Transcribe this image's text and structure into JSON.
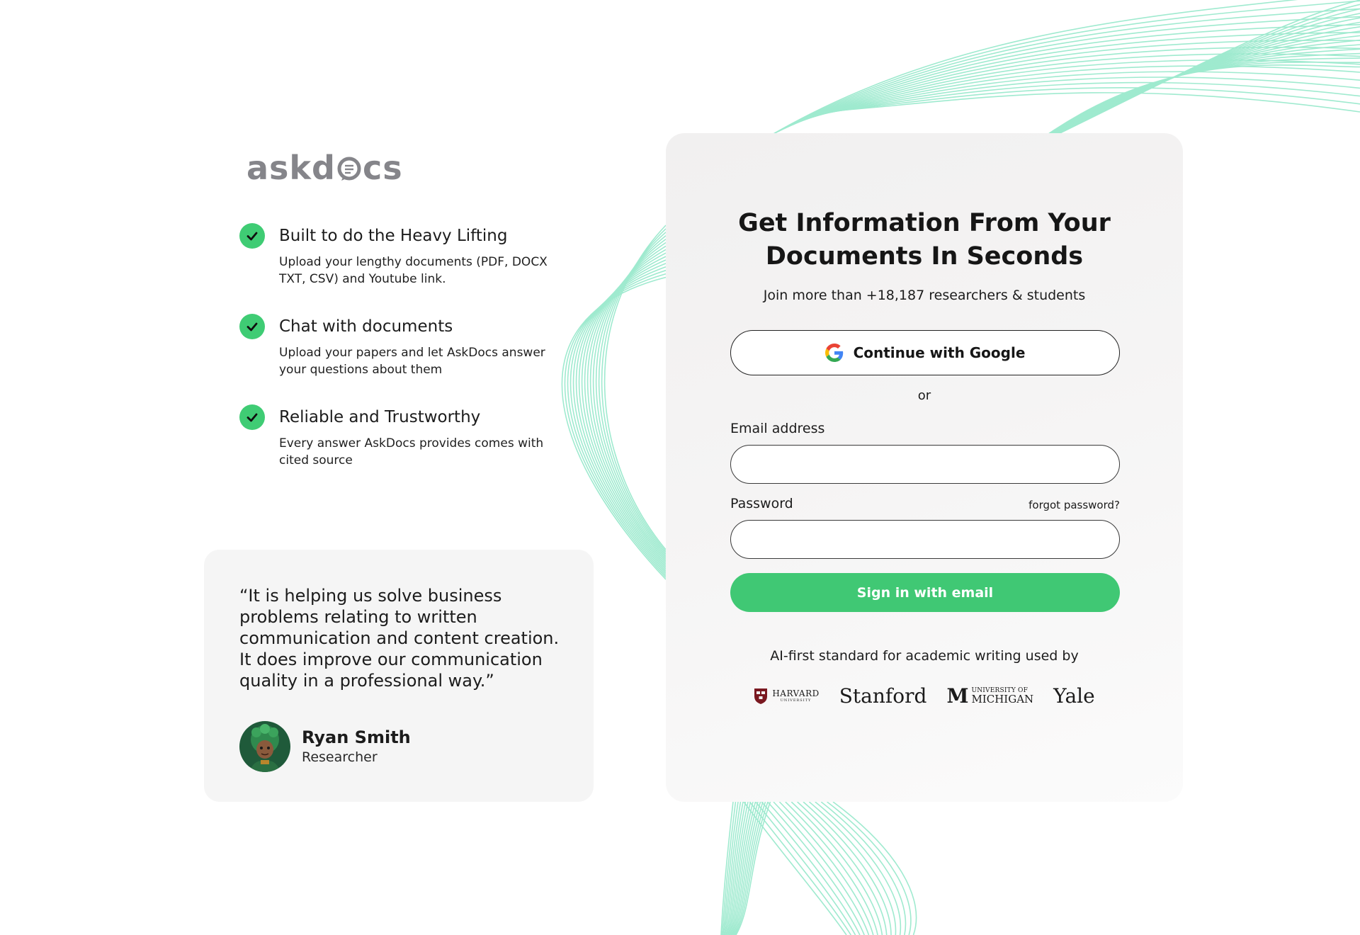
{
  "brand": {
    "logo_prefix": "askd",
    "logo_suffix": "cs",
    "accent_color": "#3fcc74",
    "wave_color": "#7fe3bf"
  },
  "features": [
    {
      "title": "Built to do the Heavy Lifting",
      "description": "Upload your lengthy documents (PDF, DOCX TXT, CSV) and Youtube link."
    },
    {
      "title": "Chat with documents",
      "description": "Upload your papers and let AskDocs answer your questions about them"
    },
    {
      "title": "Reliable and Trustworthy",
      "description": "Every answer AskDocs provides comes with cited source"
    }
  ],
  "testimonial": {
    "quote": "“It is helping us solve business problems relating to written communication and content creation. It does improve our communication quality in a professional way.”",
    "author_name": "Ryan Smith",
    "author_role": "Researcher"
  },
  "login": {
    "title_line1": "Get Information From Your",
    "title_line2": "Documents In Seconds",
    "subtitle": "Join more than +18,187 researchers & students",
    "google_button": "Continue with Google",
    "or_text": "or",
    "email_label": "Email address",
    "email_value": "",
    "password_label": "Password",
    "password_value": "",
    "forgot_password": "forgot password?",
    "signin_button": "Sign in with email",
    "used_by": "AI-first standard for academic writing used by"
  },
  "universities": {
    "harvard_line1": "HARVARD",
    "harvard_line2": "UNIVERSITY",
    "stanford": "Stanford",
    "michigan_mark": "M",
    "michigan_line1": "UNIVERSITY OF",
    "michigan_line2": "MICHIGAN",
    "yale": "Yale"
  }
}
